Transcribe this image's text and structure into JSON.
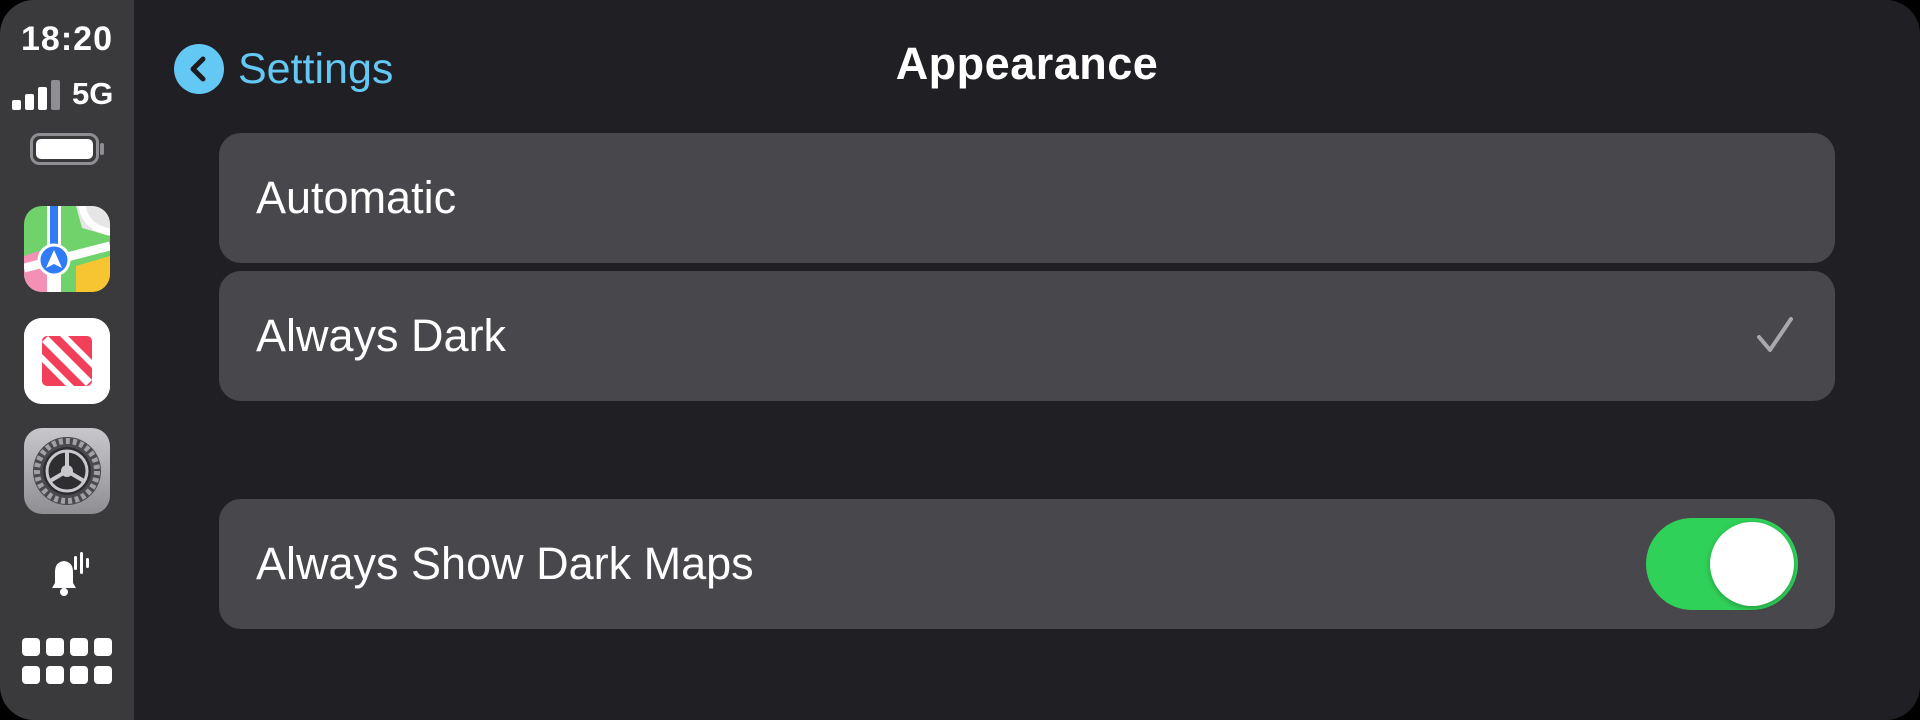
{
  "status": {
    "time": "18:20",
    "network": "5G",
    "signal_bars_filled": 3,
    "signal_bars_total": 4,
    "battery_level": 1.0
  },
  "sidebar": {
    "apps": [
      {
        "name": "maps-icon"
      },
      {
        "name": "news-icon"
      },
      {
        "name": "settings-icon"
      }
    ],
    "notification_icon": "bell-with-sound-icon",
    "app_grid_icon": "app-grid-icon"
  },
  "nav": {
    "back_label": "Settings",
    "title": "Appearance"
  },
  "options": {
    "automatic": {
      "label": "Automatic",
      "selected": false
    },
    "always_dark": {
      "label": "Always Dark",
      "selected": true
    }
  },
  "maps_setting": {
    "label": "Always Show Dark Maps",
    "enabled": true
  },
  "colors": {
    "accent": "#64c8f5",
    "toggle_on": "#30d158",
    "row_bg": "#48484c",
    "panel_bg": "#202024",
    "sidebar_bg": "#3a3a3c"
  }
}
